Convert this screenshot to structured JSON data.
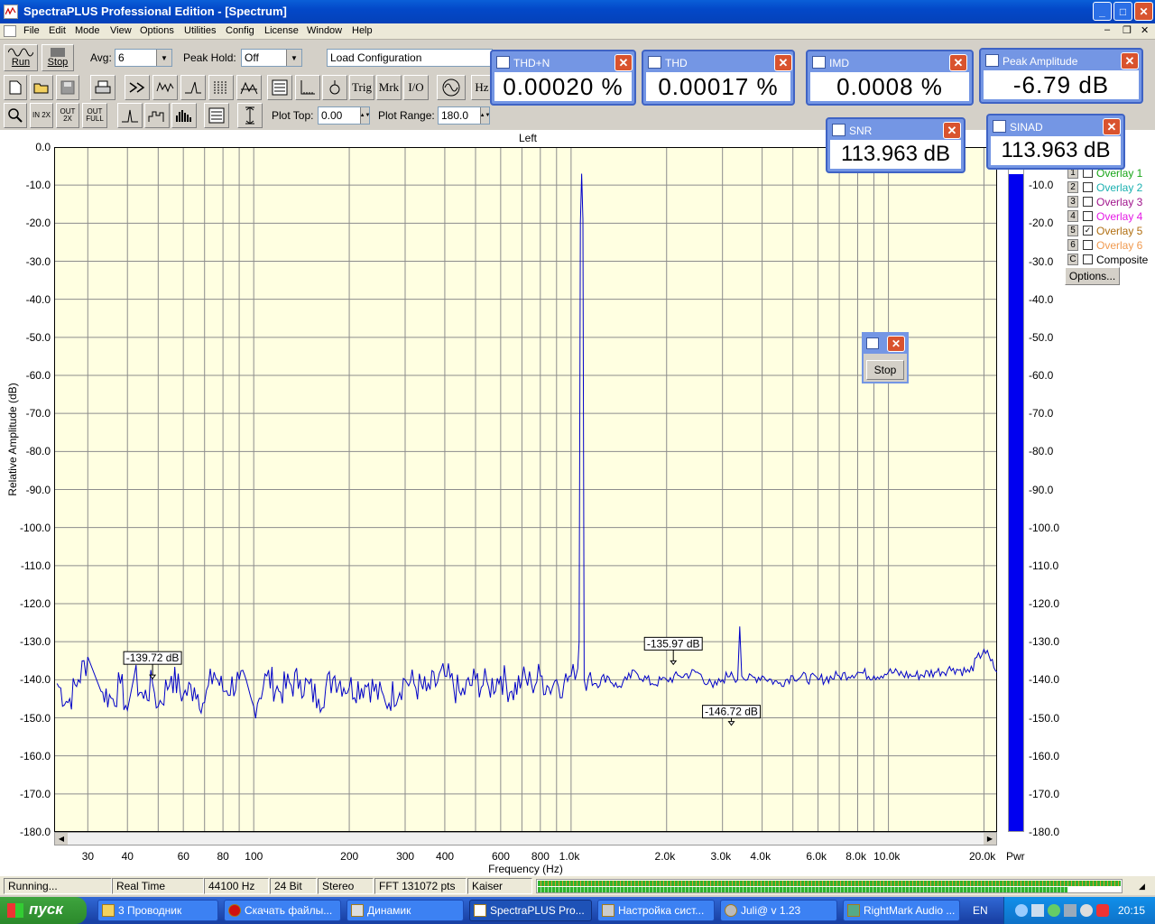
{
  "window": {
    "title": "SpectraPLUS Professional Edition - [Spectrum]"
  },
  "menu": [
    "File",
    "Edit",
    "Mode",
    "View",
    "Options",
    "Utilities",
    "Config",
    "License",
    "Window",
    "Help"
  ],
  "toolbar": {
    "run_label": "Run",
    "stop_label": "Stop",
    "avg_label": "Avg:",
    "avg_value": "6",
    "peak_hold_label": "Peak Hold:",
    "peak_hold_value": "Off",
    "load_config": "Load Configuration",
    "trig": "Trig",
    "mrk": "Mrk",
    "io": "I/O",
    "hz": "Hz",
    "zoom_in": "IN 2X",
    "zoom_out": "OUT 2X",
    "zoom_full": "OUT FULL",
    "plot_top_label": "Plot Top:",
    "plot_top_value": "0.00",
    "plot_range_label": "Plot Range:",
    "plot_range_value": "180.0"
  },
  "meters": {
    "thdn": {
      "title": "THD+N",
      "value": "0.00020 %"
    },
    "thd": {
      "title": "THD",
      "value": "0.00017 %"
    },
    "imd": {
      "title": "IMD",
      "value": "0.0008 %"
    },
    "peak": {
      "title": "Peak Amplitude",
      "value": "-6.79 dB"
    },
    "snr": {
      "title": "SNR",
      "value": "113.963 dB"
    },
    "sinad": {
      "title": "SINAD",
      "value": "113.963 dB"
    }
  },
  "stop_dialog": {
    "button": "Stop"
  },
  "overlays": [
    {
      "n": "1",
      "label": "Overlay 1",
      "color": "#19a519",
      "checked": false
    },
    {
      "n": "2",
      "label": "Overlay 2",
      "color": "#1ab0b0",
      "checked": false
    },
    {
      "n": "3",
      "label": "Overlay 3",
      "color": "#a0148c",
      "checked": false
    },
    {
      "n": "4",
      "label": "Overlay 4",
      "color": "#e51ae5",
      "checked": false
    },
    {
      "n": "5",
      "label": "Overlay 5",
      "color": "#b06e10",
      "checked": true
    },
    {
      "n": "6",
      "label": "Overlay 6",
      "color": "#f09a50",
      "checked": false
    },
    {
      "n": "C",
      "label": "Composite",
      "color": "#000000",
      "checked": false
    }
  ],
  "options_button": "Options...",
  "chart_data": {
    "type": "line",
    "title": "Left",
    "xlabel": "Frequency (Hz)",
    "ylabel": "Relative Amplitude (dB)",
    "x_scale": "log",
    "xlim": [
      23.5,
      22000
    ],
    "ylim": [
      -180,
      0
    ],
    "grid": true,
    "x_tick_labels": [
      "30",
      "40",
      "60",
      "80",
      "100",
      "200",
      "300",
      "400",
      "600",
      "800",
      "1.0k",
      "2.0k",
      "3.0k",
      "4.0k",
      "6.0k",
      "8.0k",
      "10.0k",
      "20.0k"
    ],
    "x_ticks": [
      30,
      40,
      60,
      80,
      100,
      200,
      300,
      400,
      600,
      800,
      1000,
      2000,
      3000,
      4000,
      6000,
      8000,
      10000,
      20000
    ],
    "y_tick_labels": [
      "0.0",
      "-10.0",
      "-20.0",
      "-30.0",
      "-40.0",
      "-50.0",
      "-60.0",
      "-70.0",
      "-80.0",
      "-90.0",
      "-100.0",
      "-110.0",
      "-120.0",
      "-130.0",
      "-140.0",
      "-150.0",
      "-160.0",
      "-170.0",
      "-180.0"
    ],
    "right_y_tick_labels": [
      "-10.0",
      "-20.0",
      "-30.0",
      "-40.0",
      "-50.0",
      "-60.0",
      "-70.0",
      "-80.0",
      "-90.0",
      "-100.0",
      "-110.0",
      "-120.0",
      "-130.0",
      "-140.0",
      "-150.0",
      "-160.0",
      "-170.0",
      "-180.0"
    ],
    "series": [
      {
        "color": "#0000c8",
        "x": [
          24,
          26,
          28,
          30,
          33,
          36,
          38,
          40,
          42,
          45,
          48,
          50,
          55,
          60,
          65,
          70,
          75,
          80,
          90,
          100,
          110,
          120,
          140,
          160,
          180,
          200,
          230,
          260,
          300,
          350,
          400,
          450,
          500,
          550,
          600,
          650,
          700,
          750,
          800,
          850,
          900,
          950,
          1000,
          1030,
          1050,
          1060,
          1070,
          1080,
          1090,
          1100,
          1150,
          1200,
          1300,
          1400,
          1500,
          1600,
          1800,
          2000,
          2200,
          2500,
          2800,
          3000,
          3200,
          3350,
          3400,
          3450,
          3600,
          4000,
          4500,
          5000,
          6000,
          7000,
          8000,
          9000,
          10000,
          12000,
          14000,
          16000,
          18000,
          20000,
          21000,
          22000
        ],
        "y": [
          -141,
          -146,
          -140,
          -134,
          -143,
          -145,
          -141,
          -148,
          -139,
          -145,
          -141,
          -147,
          -139,
          -144,
          -142,
          -146,
          -138,
          -143,
          -140,
          -147,
          -139,
          -143,
          -140,
          -145,
          -139,
          -142,
          -141,
          -146,
          -140,
          -143,
          -139,
          -144,
          -140,
          -142,
          -139,
          -143,
          -140,
          -141,
          -139,
          -142,
          -140,
          -141,
          -139,
          -140,
          -137,
          -130,
          -20,
          -7,
          -19,
          -140,
          -138,
          -141,
          -139,
          -142,
          -140,
          -138,
          -141,
          -140,
          -139,
          -138,
          -142,
          -140,
          -138,
          -140,
          -126,
          -139,
          -140,
          -139,
          -141,
          -139,
          -140,
          -139,
          -138,
          -139,
          -138,
          -139,
          -138,
          -137,
          -138,
          -132,
          -135,
          -138
        ]
      }
    ],
    "annotations": [
      {
        "label": "-139.72 dB",
        "x": 48,
        "y": -139.72
      },
      {
        "label": "-135.97 dB",
        "x": 2100,
        "y": -135.97
      },
      {
        "label": "-146.72 dB",
        "x": 3200,
        "y": -146.72
      }
    ],
    "power_bar": {
      "label": "Pwr",
      "level_db": -6.79
    }
  },
  "status": {
    "state": "Running...",
    "mode": "Real Time",
    "rate": "44100 Hz",
    "bits": "24 Bit",
    "channels": "Stereo",
    "fft": "FFT 131072 pts",
    "window": "Kaiser"
  },
  "taskbar": {
    "start": "пуск",
    "tasks": [
      "3 Проводник",
      "Скачать файлы...",
      "Динамик",
      "SpectraPLUS Pro...",
      "Настройка сист...",
      "Juli@ v 1.23",
      "RightMark Audio ..."
    ],
    "lang": "EN",
    "clock": "20:15"
  }
}
